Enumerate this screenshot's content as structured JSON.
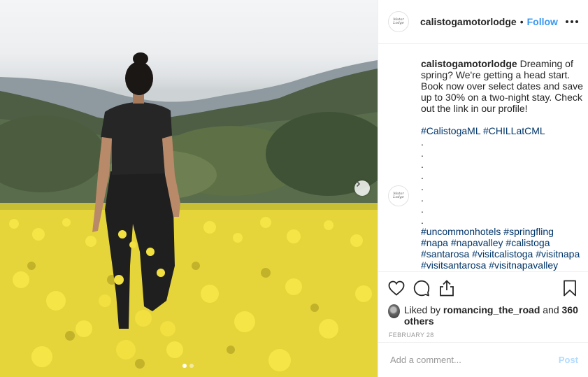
{
  "post": {
    "username": "calistogamotorlodge",
    "separator": "•",
    "follow_label": "Follow",
    "avatar_text": "Motor Lodge"
  },
  "caption": {
    "username": "calistogamotorlodge",
    "text": "Dreaming of spring? We're getting a head start. Book now over select dates and save up to 30% on a two-night stay. Check out the link in our profile!",
    "hashtags_1": "#CalistogaML #CHILLatCML",
    "dots": [
      ".",
      ".",
      ".",
      ".",
      ".",
      ".",
      ".",
      "."
    ],
    "hashtags_2": "#uncommonhotels #springfling #napa #napavalley #calistoga #santarosa #visitcalistoga #visitnapa #visitsantarosa #visitnapavalley"
  },
  "likes": {
    "prefix": "Liked by",
    "user": "romancing_the_road",
    "conjunction": "and",
    "others": "360 others"
  },
  "date": "FEBRUARY 28",
  "comment_box": {
    "placeholder": "Add a comment...",
    "post_label": "Post"
  },
  "carousel": {
    "slides": 2,
    "active_index": 0
  },
  "colors": {
    "accent": "#3897f0",
    "hashtag": "#003569",
    "field_yellow": "#f3e23a",
    "post_disabled": "#b3dbff"
  },
  "icons": {
    "like": "heart-icon",
    "comment": "comment-bubble-icon",
    "share": "share-icon",
    "save": "bookmark-icon",
    "next": "chevron-right-icon",
    "more": "more-options-icon"
  }
}
